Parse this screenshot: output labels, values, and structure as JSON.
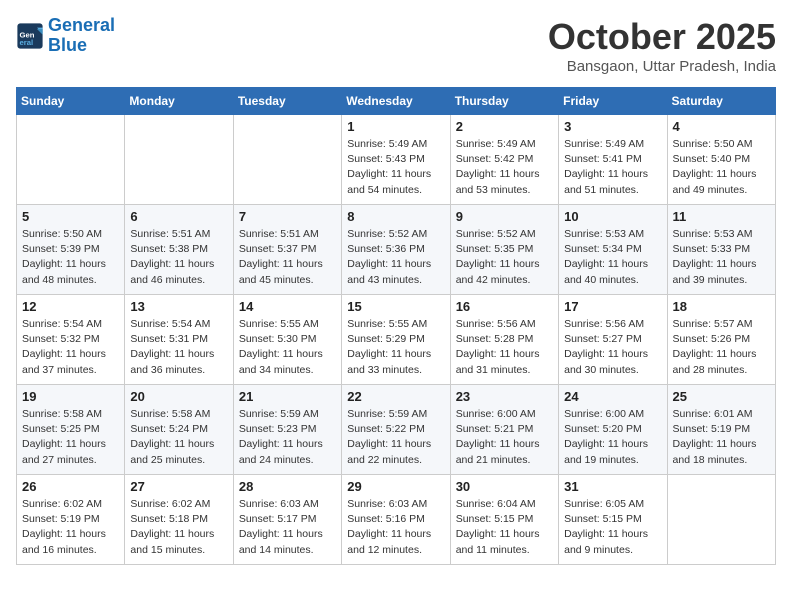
{
  "logo": {
    "line1": "General",
    "line2": "Blue"
  },
  "title": "October 2025",
  "subtitle": "Bansgaon, Uttar Pradesh, India",
  "headers": [
    "Sunday",
    "Monday",
    "Tuesday",
    "Wednesday",
    "Thursday",
    "Friday",
    "Saturday"
  ],
  "weeks": [
    [
      {
        "day": "",
        "info": ""
      },
      {
        "day": "",
        "info": ""
      },
      {
        "day": "",
        "info": ""
      },
      {
        "day": "1",
        "info": "Sunrise: 5:49 AM\nSunset: 5:43 PM\nDaylight: 11 hours\nand 54 minutes."
      },
      {
        "day": "2",
        "info": "Sunrise: 5:49 AM\nSunset: 5:42 PM\nDaylight: 11 hours\nand 53 minutes."
      },
      {
        "day": "3",
        "info": "Sunrise: 5:49 AM\nSunset: 5:41 PM\nDaylight: 11 hours\nand 51 minutes."
      },
      {
        "day": "4",
        "info": "Sunrise: 5:50 AM\nSunset: 5:40 PM\nDaylight: 11 hours\nand 49 minutes."
      }
    ],
    [
      {
        "day": "5",
        "info": "Sunrise: 5:50 AM\nSunset: 5:39 PM\nDaylight: 11 hours\nand 48 minutes."
      },
      {
        "day": "6",
        "info": "Sunrise: 5:51 AM\nSunset: 5:38 PM\nDaylight: 11 hours\nand 46 minutes."
      },
      {
        "day": "7",
        "info": "Sunrise: 5:51 AM\nSunset: 5:37 PM\nDaylight: 11 hours\nand 45 minutes."
      },
      {
        "day": "8",
        "info": "Sunrise: 5:52 AM\nSunset: 5:36 PM\nDaylight: 11 hours\nand 43 minutes."
      },
      {
        "day": "9",
        "info": "Sunrise: 5:52 AM\nSunset: 5:35 PM\nDaylight: 11 hours\nand 42 minutes."
      },
      {
        "day": "10",
        "info": "Sunrise: 5:53 AM\nSunset: 5:34 PM\nDaylight: 11 hours\nand 40 minutes."
      },
      {
        "day": "11",
        "info": "Sunrise: 5:53 AM\nSunset: 5:33 PM\nDaylight: 11 hours\nand 39 minutes."
      }
    ],
    [
      {
        "day": "12",
        "info": "Sunrise: 5:54 AM\nSunset: 5:32 PM\nDaylight: 11 hours\nand 37 minutes."
      },
      {
        "day": "13",
        "info": "Sunrise: 5:54 AM\nSunset: 5:31 PM\nDaylight: 11 hours\nand 36 minutes."
      },
      {
        "day": "14",
        "info": "Sunrise: 5:55 AM\nSunset: 5:30 PM\nDaylight: 11 hours\nand 34 minutes."
      },
      {
        "day": "15",
        "info": "Sunrise: 5:55 AM\nSunset: 5:29 PM\nDaylight: 11 hours\nand 33 minutes."
      },
      {
        "day": "16",
        "info": "Sunrise: 5:56 AM\nSunset: 5:28 PM\nDaylight: 11 hours\nand 31 minutes."
      },
      {
        "day": "17",
        "info": "Sunrise: 5:56 AM\nSunset: 5:27 PM\nDaylight: 11 hours\nand 30 minutes."
      },
      {
        "day": "18",
        "info": "Sunrise: 5:57 AM\nSunset: 5:26 PM\nDaylight: 11 hours\nand 28 minutes."
      }
    ],
    [
      {
        "day": "19",
        "info": "Sunrise: 5:58 AM\nSunset: 5:25 PM\nDaylight: 11 hours\nand 27 minutes."
      },
      {
        "day": "20",
        "info": "Sunrise: 5:58 AM\nSunset: 5:24 PM\nDaylight: 11 hours\nand 25 minutes."
      },
      {
        "day": "21",
        "info": "Sunrise: 5:59 AM\nSunset: 5:23 PM\nDaylight: 11 hours\nand 24 minutes."
      },
      {
        "day": "22",
        "info": "Sunrise: 5:59 AM\nSunset: 5:22 PM\nDaylight: 11 hours\nand 22 minutes."
      },
      {
        "day": "23",
        "info": "Sunrise: 6:00 AM\nSunset: 5:21 PM\nDaylight: 11 hours\nand 21 minutes."
      },
      {
        "day": "24",
        "info": "Sunrise: 6:00 AM\nSunset: 5:20 PM\nDaylight: 11 hours\nand 19 minutes."
      },
      {
        "day": "25",
        "info": "Sunrise: 6:01 AM\nSunset: 5:19 PM\nDaylight: 11 hours\nand 18 minutes."
      }
    ],
    [
      {
        "day": "26",
        "info": "Sunrise: 6:02 AM\nSunset: 5:19 PM\nDaylight: 11 hours\nand 16 minutes."
      },
      {
        "day": "27",
        "info": "Sunrise: 6:02 AM\nSunset: 5:18 PM\nDaylight: 11 hours\nand 15 minutes."
      },
      {
        "day": "28",
        "info": "Sunrise: 6:03 AM\nSunset: 5:17 PM\nDaylight: 11 hours\nand 14 minutes."
      },
      {
        "day": "29",
        "info": "Sunrise: 6:03 AM\nSunset: 5:16 PM\nDaylight: 11 hours\nand 12 minutes."
      },
      {
        "day": "30",
        "info": "Sunrise: 6:04 AM\nSunset: 5:15 PM\nDaylight: 11 hours\nand 11 minutes."
      },
      {
        "day": "31",
        "info": "Sunrise: 6:05 AM\nSunset: 5:15 PM\nDaylight: 11 hours\nand 9 minutes."
      },
      {
        "day": "",
        "info": ""
      }
    ]
  ]
}
